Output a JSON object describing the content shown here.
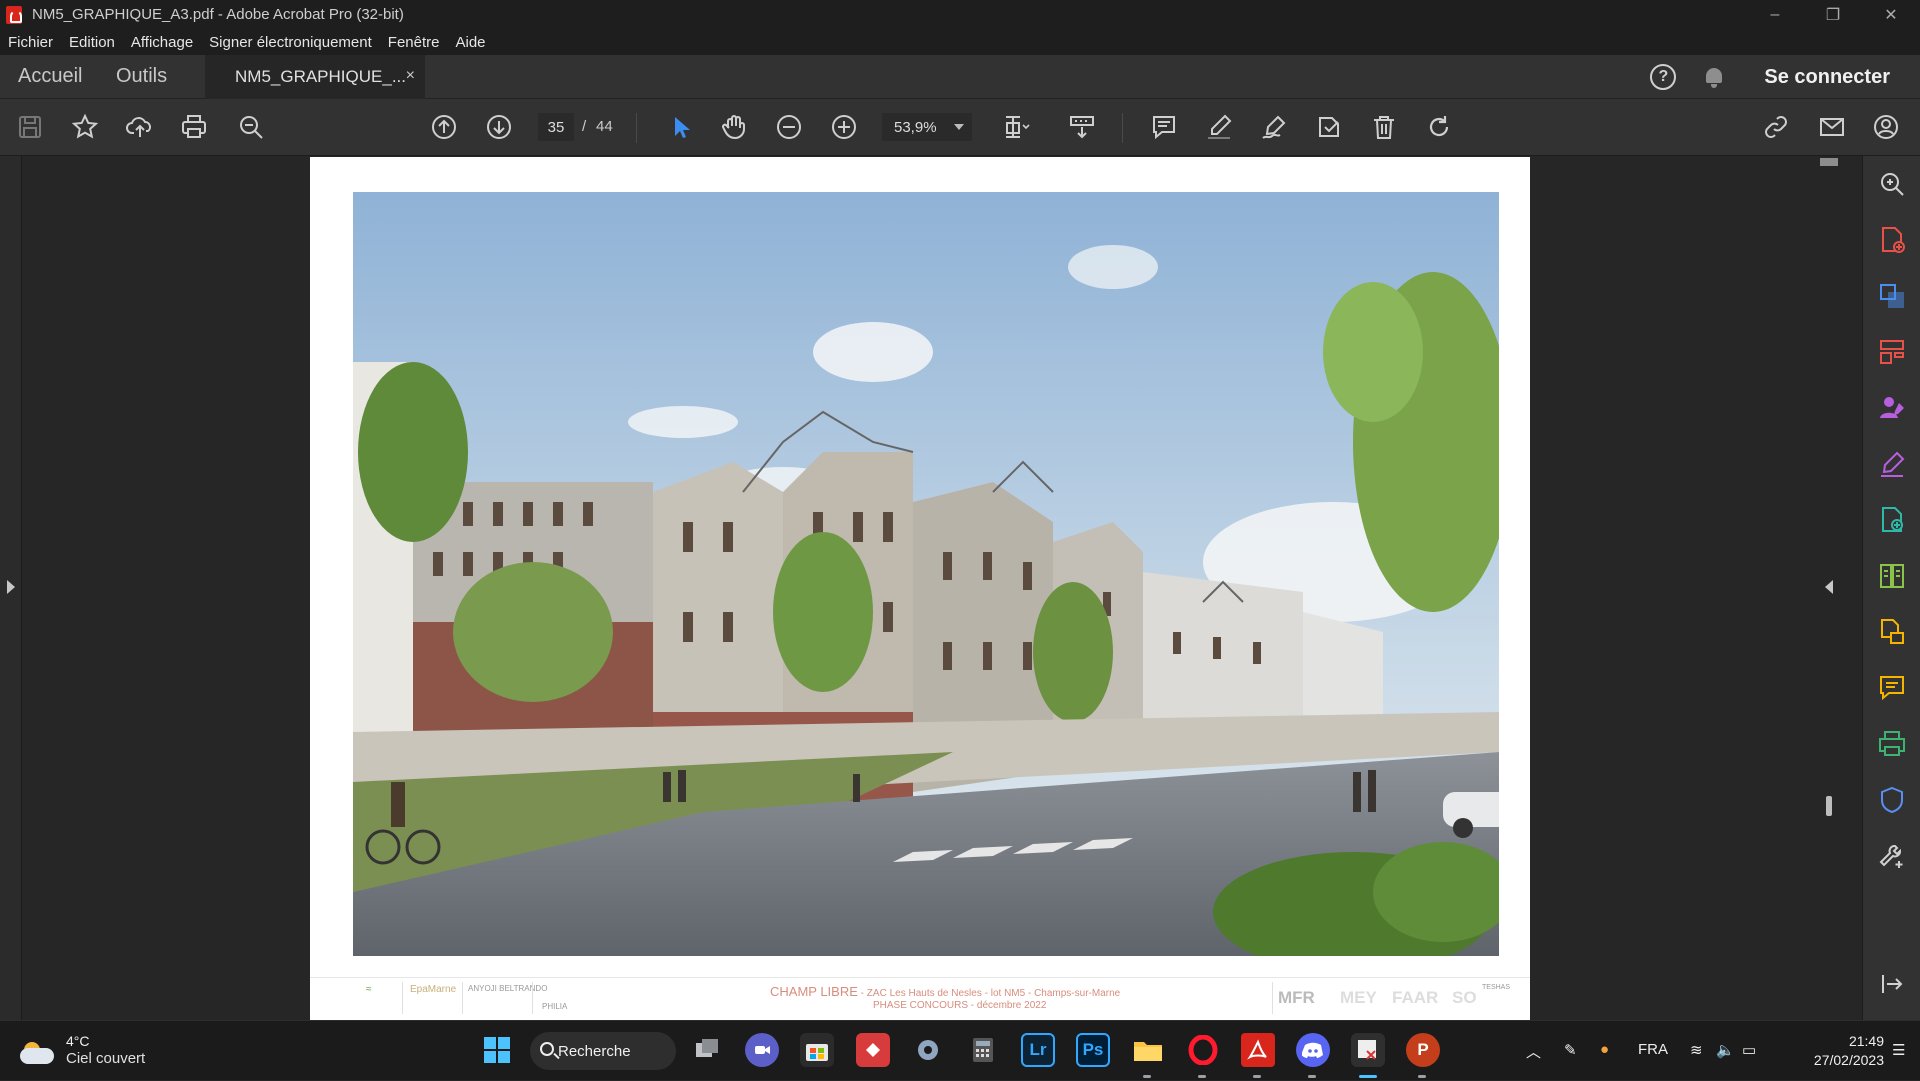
{
  "window": {
    "title": "NM5_GRAPHIQUE_A3.pdf - Adobe Acrobat Pro (32-bit)",
    "controls": [
      "–",
      "❐",
      "✕"
    ]
  },
  "menu": [
    "Fichier",
    "Edition",
    "Affichage",
    "Signer électroniquement",
    "Fenêtre",
    "Aide"
  ],
  "tabs": {
    "home": "Accueil",
    "tools": "Outils",
    "document": "NM5_GRAPHIQUE_...",
    "close": "×",
    "signin": "Se connecter",
    "help": "?"
  },
  "toolbar": {
    "current_page": "35",
    "separator": "/",
    "total_pages": "44",
    "zoom": "53,9%"
  },
  "document": {
    "footer_title": "CHAMP LIBRE",
    "footer_subtitle": " - ZAC Les Hauts de Nesles - lot NM5 - Champs-sur-Marne",
    "footer_phase": "PHASE CONCOURS - décembre 2022",
    "logos": [
      "EpaMarne",
      "ANYOJI BELTRANDO",
      "PHILIA",
      "MFR",
      "MEY",
      "FAAR",
      "SO",
      "TESHAS"
    ]
  },
  "taskbar": {
    "weather_temp": "4°C",
    "weather_desc": "Ciel couvert",
    "search": "Recherche",
    "lr": "Lr",
    "ps": "Ps",
    "language": "FRA",
    "time": "21:49",
    "date": "27/02/2023"
  },
  "colors": {
    "accent": "#4cc2ff",
    "acrobat_red": "#d9261c",
    "select_tool": "#3b8ef0"
  }
}
